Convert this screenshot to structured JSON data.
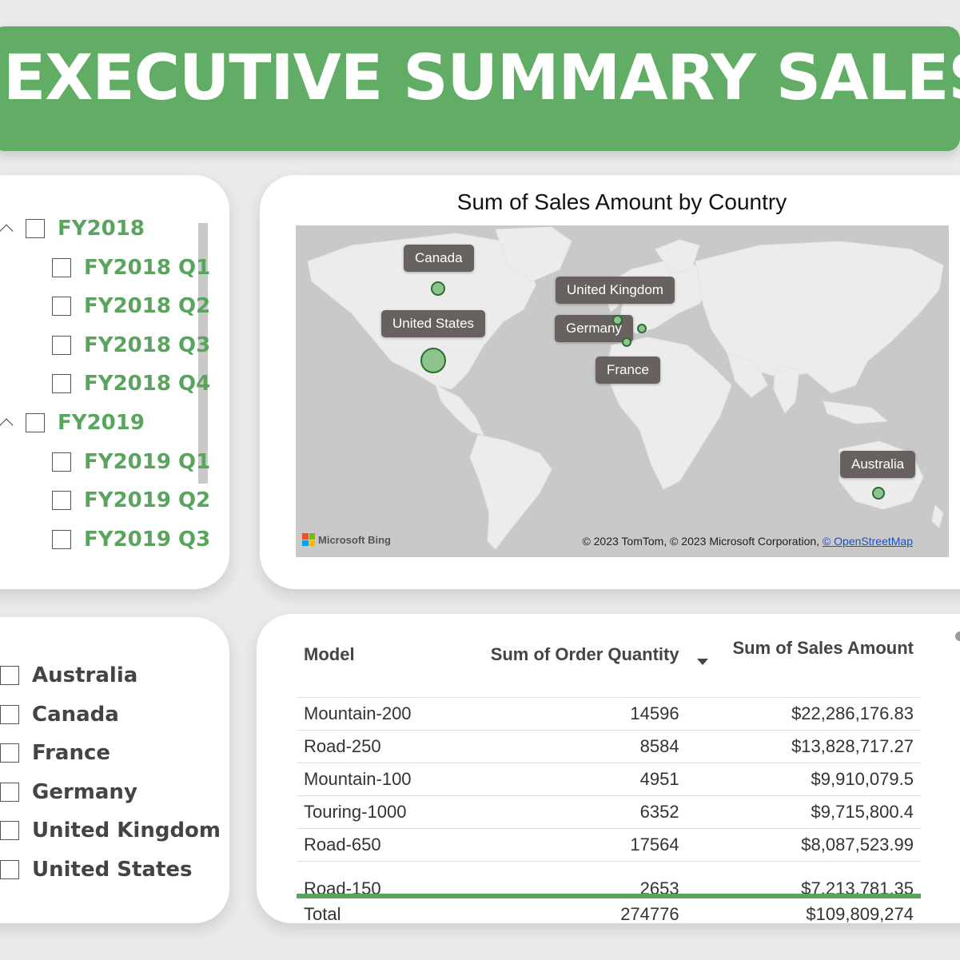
{
  "title": "EXECUTIVE SUMMARY SALES",
  "date_slicer": {
    "groups": [
      {
        "label": "FY2018",
        "items": [
          "FY2018 Q1",
          "FY2018 Q2",
          "FY2018 Q3",
          "FY2018 Q4"
        ]
      },
      {
        "label": "FY2019",
        "items": [
          "FY2019 Q1",
          "FY2019 Q2",
          "FY2019 Q3"
        ]
      }
    ]
  },
  "country_slicer": {
    "items": [
      "Australia",
      "Canada",
      "France",
      "Germany",
      "United Kingdom",
      "United States"
    ]
  },
  "map": {
    "title": "Sum of Sales Amount by Country",
    "labels": [
      "Canada",
      "United Kingdom",
      "United States",
      "Germany",
      "France",
      "Australia"
    ],
    "attribution_brand": "Microsoft Bing",
    "attribution_text": "© 2023 TomTom, © 2023 Microsoft Corporation, ",
    "attribution_link": "© OpenStreetMap",
    "colors": {
      "bubble_fill": "#8cc48b",
      "bubble_stroke": "#2e6b30",
      "label_bg": "#676260"
    }
  },
  "table": {
    "headers": [
      "Model",
      "Sum of Order Quantity",
      "Sum of Sales Amount"
    ],
    "sorted_column": "Sum of Sales Amount",
    "rows": [
      {
        "model": "Mountain-200",
        "qty": "14596",
        "amount": "$22,286,176.83"
      },
      {
        "model": "Road-250",
        "qty": "8584",
        "amount": "$13,828,717.27"
      },
      {
        "model": "Mountain-100",
        "qty": "4951",
        "amount": "$9,910,079.5"
      },
      {
        "model": "Touring-1000",
        "qty": "6352",
        "amount": "$9,715,800.4"
      },
      {
        "model": "Road-650",
        "qty": "17564",
        "amount": "$8,087,523.99"
      },
      {
        "model": "Road-150",
        "qty": "2653",
        "amount": "$7,213,781.35"
      }
    ],
    "total": {
      "label": "Total",
      "qty": "274776",
      "amount": "$109,809,274"
    }
  },
  "theme": {
    "accent": "#62ad65",
    "text_green": "#5aa55d"
  }
}
